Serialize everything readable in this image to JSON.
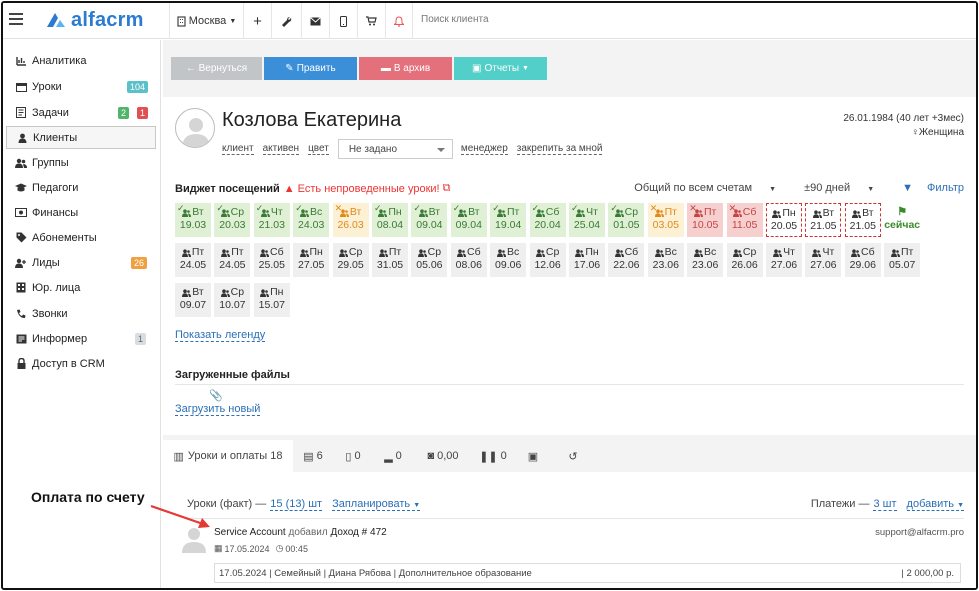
{
  "app": {
    "logo_text": "alfacrm",
    "brand_color": "#2c7bd3"
  },
  "topbar": {
    "branch": "Москва",
    "search_placeholder": "Поиск клиента"
  },
  "sidebar": {
    "items": [
      {
        "label": "Аналитика",
        "icon": "analytics-icon"
      },
      {
        "label": "Уроки",
        "icon": "calendar-icon",
        "badge": "104"
      },
      {
        "label": "Задачи",
        "icon": "tasks-icon",
        "badge_green": "2",
        "badge_red": "1"
      },
      {
        "label": "Клиенты",
        "icon": "user-icon"
      },
      {
        "label": "Группы",
        "icon": "group-icon"
      },
      {
        "label": "Педагоги",
        "icon": "teacher-icon"
      },
      {
        "label": "Финансы",
        "icon": "finance-icon"
      },
      {
        "label": "Абонементы",
        "icon": "tag-icon"
      },
      {
        "label": "Лиды",
        "icon": "leads-icon",
        "badge": "26"
      },
      {
        "label": "Юр. лица",
        "icon": "building-icon"
      },
      {
        "label": "Звонки",
        "icon": "phone-icon"
      },
      {
        "label": "Информер",
        "icon": "informer-icon",
        "badge": "1"
      },
      {
        "label": "Доступ в CRM",
        "icon": "lock-icon"
      }
    ]
  },
  "actions": {
    "back": "← Вернуться",
    "edit": "Править",
    "archive": "В архив",
    "reports": "Отчеты"
  },
  "client": {
    "name": "Козлова Екатерина",
    "dob": "26.01.1984 (40 лет +3мес)",
    "gender": "Женщина",
    "links": [
      "клиент",
      "активен",
      "цвет"
    ],
    "select_value": "Не задано",
    "manager_label": "менеджер",
    "assign_label": "закрепить за мной"
  },
  "widget": {
    "title": "Виджет посещений",
    "warning": "Есть непроведенные уроки!",
    "accounts": "Общий по всем счетам",
    "period": "±90 дней",
    "filter": "Фильтр",
    "cells": [
      {
        "d": "Вт",
        "t": "19.03",
        "s": "green"
      },
      {
        "d": "Ср",
        "t": "20.03",
        "s": "green"
      },
      {
        "d": "Чт",
        "t": "21.03",
        "s": "green"
      },
      {
        "d": "Вс",
        "t": "24.03",
        "s": "green"
      },
      {
        "d": "Вт",
        "t": "26.03",
        "s": "orange"
      },
      {
        "d": "Пн",
        "t": "08.04",
        "s": "green"
      },
      {
        "d": "Вт",
        "t": "09.04",
        "s": "green"
      },
      {
        "d": "Вт",
        "t": "09.04",
        "s": "green"
      },
      {
        "d": "Пт",
        "t": "19.04",
        "s": "green"
      },
      {
        "d": "Сб",
        "t": "20.04",
        "s": "green"
      },
      {
        "d": "Чт",
        "t": "25.04",
        "s": "green"
      },
      {
        "d": "Ср",
        "t": "01.05",
        "s": "green"
      },
      {
        "d": "Пт",
        "t": "03.05",
        "s": "orange"
      },
      {
        "d": "Пт",
        "t": "10.05",
        "s": "red"
      },
      {
        "d": "Сб",
        "t": "11.05",
        "s": "red"
      },
      {
        "d": "Пн",
        "t": "20.05",
        "s": "dash"
      },
      {
        "d": "Вт",
        "t": "21.05",
        "s": "dash"
      },
      {
        "d": "Вт",
        "t": "21.05",
        "s": "dash"
      },
      {
        "d": "",
        "t": "сейчас",
        "s": "now"
      },
      {
        "d": "Пт",
        "t": "24.05",
        "s": "grey"
      },
      {
        "d": "Пт",
        "t": "24.05",
        "s": "grey"
      },
      {
        "d": "Сб",
        "t": "25.05",
        "s": "grey"
      },
      {
        "d": "Пн",
        "t": "27.05",
        "s": "grey"
      },
      {
        "d": "Ср",
        "t": "29.05",
        "s": "grey"
      },
      {
        "d": "Пт",
        "t": "31.05",
        "s": "grey"
      },
      {
        "d": "Ср",
        "t": "05.06",
        "s": "grey"
      },
      {
        "d": "Сб",
        "t": "08.06",
        "s": "grey"
      },
      {
        "d": "Вс",
        "t": "09.06",
        "s": "grey"
      },
      {
        "d": "Ср",
        "t": "12.06",
        "s": "grey"
      },
      {
        "d": "Пн",
        "t": "17.06",
        "s": "grey"
      },
      {
        "d": "Сб",
        "t": "22.06",
        "s": "grey"
      },
      {
        "d": "Вс",
        "t": "23.06",
        "s": "grey"
      },
      {
        "d": "Вс",
        "t": "23.06",
        "s": "grey"
      },
      {
        "d": "Ср",
        "t": "26.06",
        "s": "grey"
      },
      {
        "d": "Чт",
        "t": "27.06",
        "s": "grey"
      },
      {
        "d": "Чт",
        "t": "27.06",
        "s": "grey"
      },
      {
        "d": "Сб",
        "t": "29.06",
        "s": "grey"
      },
      {
        "d": "Пт",
        "t": "05.07",
        "s": "grey"
      },
      {
        "d": "Вт",
        "t": "09.07",
        "s": "grey"
      },
      {
        "d": "Ср",
        "t": "10.07",
        "s": "grey"
      },
      {
        "d": "Пн",
        "t": "15.07",
        "s": "grey"
      }
    ],
    "legend_link": "Показать легенду"
  },
  "files": {
    "title": "Загруженные файлы",
    "upload": "Загрузить новый"
  },
  "tabs": [
    {
      "label": "Уроки и оплаты 18",
      "icon": "book-icon"
    },
    {
      "label": "6",
      "icon": "comments-icon"
    },
    {
      "label": "0",
      "icon": "docs-icon"
    },
    {
      "label": "0",
      "icon": "chart-icon"
    },
    {
      "label": "0,00",
      "icon": "gift-icon"
    },
    {
      "label": "0",
      "icon": "pause-icon"
    },
    {
      "label": "",
      "icon": "money-icon"
    },
    {
      "label": "",
      "icon": "history-icon"
    }
  ],
  "lessons": {
    "fact_label": "Уроки (факт) —",
    "fact_value": "15 (13) шт",
    "plan_label": "Запланировать",
    "payments_label": "Платежи —",
    "payments_value": "3 шт",
    "add_label": "добавить"
  },
  "event": {
    "author": "Service Account",
    "action": "добавил",
    "object": "Доход # 472",
    "date": "17.05.2024",
    "time": "00:45",
    "email": "support@alfacrm.pro",
    "detail": "17.05.2024 | Семейный | Диана Рябова | Дополнительное образование",
    "amount": "| 2 000,00 р."
  },
  "annotation": {
    "text": "Оплата по счету",
    "color": "#e53935"
  }
}
